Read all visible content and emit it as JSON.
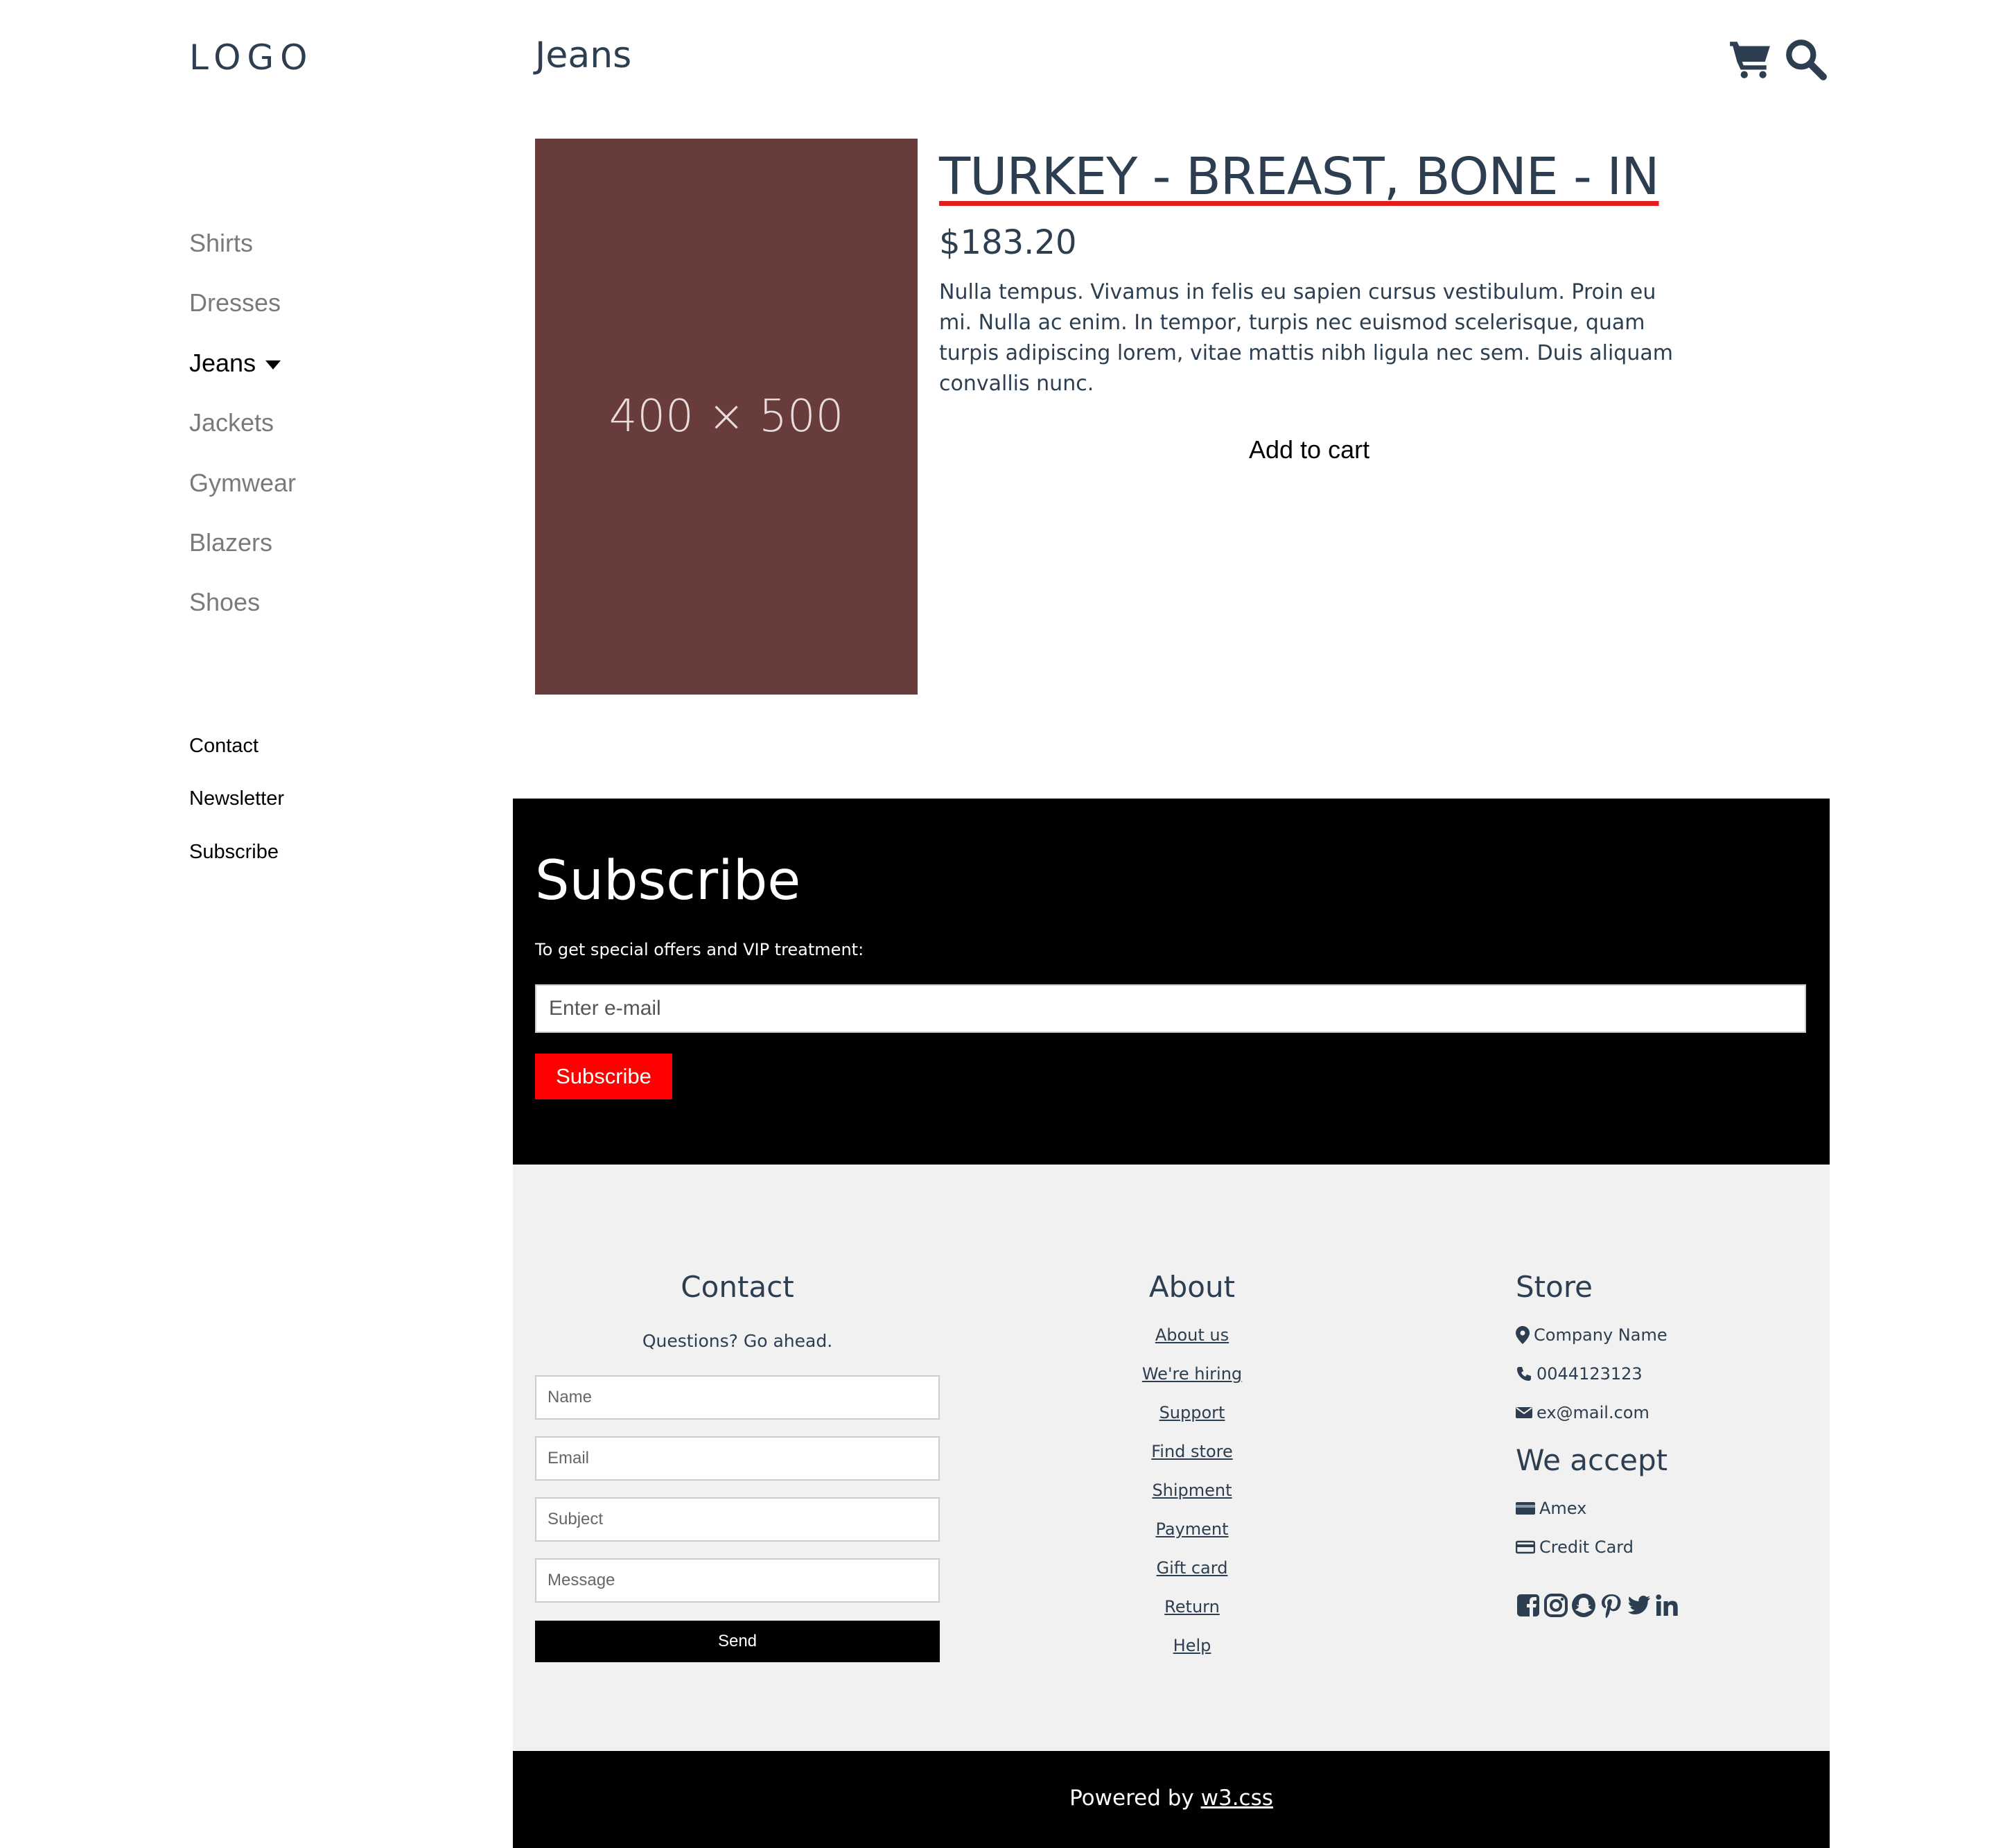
{
  "header": {
    "logo": "LOGO",
    "page_title": "Jeans",
    "cart_icon": "cart-icon",
    "search_icon": "search-icon"
  },
  "sidebar": {
    "categories": [
      "Shirts",
      "Dresses",
      "Jeans",
      "Jackets",
      "Gymwear",
      "Blazers",
      "Shoes"
    ],
    "active": "Jeans",
    "links": [
      "Contact",
      "Newsletter",
      "Subscribe"
    ]
  },
  "product": {
    "image_label": "400 × 500",
    "image_color": "#693c3c",
    "title": "TURKEY - BREAST, BONE - IN",
    "price": "$183.20",
    "description": "Nulla tempus. Vivamus in felis eu sapien cursus vestibulum. Proin eu mi. Nulla ac enim. In tempor, turpis nec euismod scelerisque, quam turpis adipiscing lorem, vitae mattis nibh ligula nec sem. Duis aliquam convallis nunc.",
    "add_to_cart": "Add to cart"
  },
  "subscribe": {
    "title": "Subscribe",
    "text": "To get special offers and VIP treatment:",
    "email_placeholder": "Enter e-mail",
    "button": "Subscribe",
    "button_color": "#ff0000"
  },
  "footer": {
    "contact": {
      "heading": "Contact",
      "subtitle": "Questions? Go ahead.",
      "name_placeholder": "Name",
      "email_placeholder": "Email",
      "subject_placeholder": "Subject",
      "message_placeholder": "Message",
      "send": "Send"
    },
    "about": {
      "heading": "About",
      "links": [
        "About us",
        "We're hiring",
        "Support",
        "Find store",
        "Shipment",
        "Payment",
        "Gift card",
        "Return",
        "Help"
      ]
    },
    "store": {
      "heading": "Store",
      "company": "Company Name",
      "phone": "0044123123",
      "email": "ex@mail.com",
      "accept_heading": "We accept",
      "amex": "Amex",
      "credit_card": "Credit Card",
      "social_icons": [
        "facebook-icon",
        "instagram-icon",
        "snapchat-icon",
        "pinterest-icon",
        "twitter-icon",
        "linkedin-icon"
      ]
    }
  },
  "bottom": {
    "powered_text": "Powered by ",
    "powered_link": "w3.css"
  }
}
